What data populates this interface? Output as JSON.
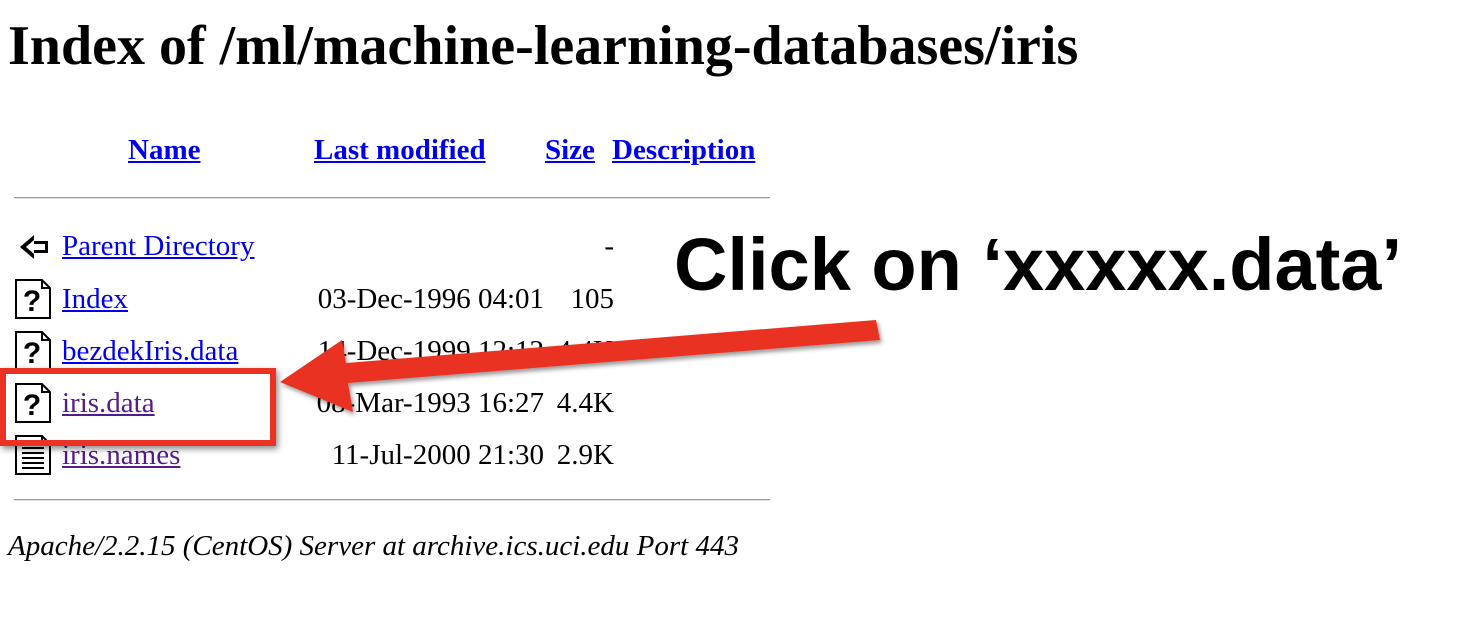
{
  "page": {
    "title": "Index of /ml/machine-learning-databases/iris"
  },
  "columns": {
    "name": "Name",
    "last_modified": "Last modified",
    "size": "Size",
    "description": "Description"
  },
  "rows": [
    {
      "name": "Parent Directory",
      "date": "",
      "size": "-",
      "icon": "back-arrow-icon",
      "visited": false
    },
    {
      "name": "Index",
      "date": "03-Dec-1996 04:01",
      "size": "105",
      "icon": "unknown-file-icon",
      "visited": false
    },
    {
      "name": "bezdekIris.data",
      "date": "14-Dec-1999 12:12",
      "size": "4.4K",
      "icon": "unknown-file-icon",
      "visited": false
    },
    {
      "name": "iris.data",
      "date": "08-Mar-1993 16:27",
      "size": "4.4K",
      "icon": "unknown-file-icon",
      "visited": true
    },
    {
      "name": "iris.names",
      "date": "11-Jul-2000 21:30",
      "size": "2.9K",
      "icon": "text-file-icon",
      "visited": true
    }
  ],
  "footer": {
    "text": "Apache/2.2.15 (CentOS) Server at archive.ics.uci.edu Port 443"
  },
  "annotation": {
    "text": "Click on ‘xxxxx.data’",
    "color": "#ea3323",
    "highlighted_item": "iris.data"
  },
  "colors": {
    "link": "#0000ee",
    "visited_link": "#551a8b"
  }
}
